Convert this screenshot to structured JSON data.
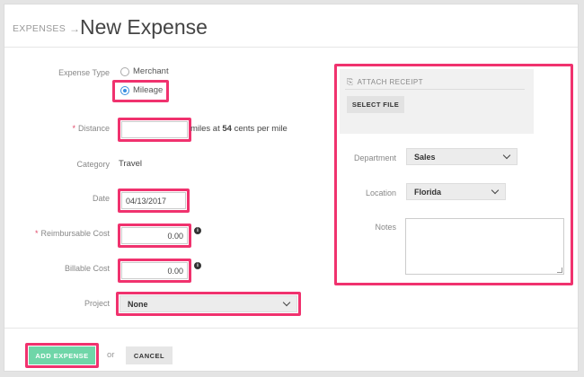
{
  "header": {
    "breadcrumb": "EXPENSES",
    "title": "New Expense"
  },
  "form": {
    "expense_type": {
      "label": "Expense Type",
      "options": [
        "Merchant",
        "Mileage"
      ],
      "selected": "Mileage"
    },
    "distance": {
      "label": "Distance",
      "value": "",
      "suffix_pre": "miles at",
      "rate": "54",
      "suffix_post": "cents per mile"
    },
    "category": {
      "label": "Category",
      "value": "Travel"
    },
    "date": {
      "label": "Date",
      "value": "04/13/2017"
    },
    "reimbursable_cost": {
      "label": "Reimbursable Cost",
      "value": "0.00"
    },
    "billable_cost": {
      "label": "Billable Cost",
      "value": "0.00"
    },
    "project": {
      "label": "Project",
      "value": "None"
    }
  },
  "receipt": {
    "title": "ATTACH RECEIPT",
    "button": "SELECT FILE"
  },
  "side": {
    "department": {
      "label": "Department",
      "value": "Sales"
    },
    "location": {
      "label": "Location",
      "value": "Florida"
    },
    "notes": {
      "label": "Notes",
      "value": ""
    }
  },
  "footer": {
    "add": "ADD EXPENSE",
    "or": "or",
    "cancel": "CANCEL"
  },
  "colors": {
    "highlight": "#f0326e",
    "add_button": "#6fd6a8",
    "radio_selected": "#3a8fe0"
  },
  "icons": [
    "arrow-right-icon",
    "info-icon",
    "chevron-down-icon",
    "paperclip-icon",
    "resize-grip-icon"
  ]
}
